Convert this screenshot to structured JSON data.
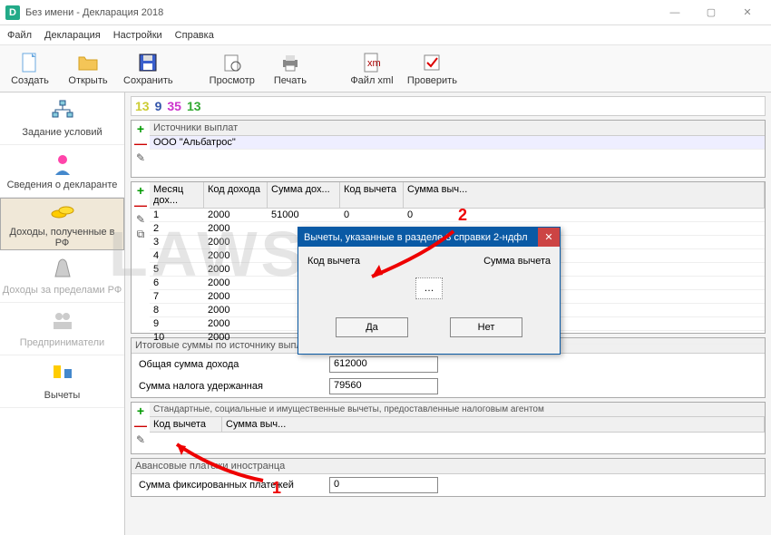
{
  "window": {
    "title": "Без имени - Декларация 2018"
  },
  "menu": [
    "Файл",
    "Декларация",
    "Настройки",
    "Справка"
  ],
  "toolbar": [
    {
      "label": "Создать",
      "icon": "file"
    },
    {
      "label": "Открыть",
      "icon": "folder"
    },
    {
      "label": "Сохранить",
      "icon": "disk"
    },
    {
      "label": "Просмотр",
      "icon": "preview"
    },
    {
      "label": "Печать",
      "icon": "printer"
    },
    {
      "label": "Файл xml",
      "icon": "xml"
    },
    {
      "label": "Проверить",
      "icon": "check"
    }
  ],
  "nav": [
    "Задание условий",
    "Сведения о декларанте",
    "Доходы, полученные в РФ",
    "Доходы за пределами РФ",
    "Предприниматели",
    "Вычеты"
  ],
  "nums": [
    "13",
    "9",
    "35",
    "13"
  ],
  "sources": {
    "header": "Источники выплат",
    "row": "ООО \"Альбатрос\""
  },
  "income_cols": [
    "Месяц дох...",
    "Код дохода",
    "Сумма дох...",
    "Код вычета",
    "Сумма выч..."
  ],
  "income_rows": [
    {
      "m": "1",
      "k": "2000",
      "s": "51000",
      "kv": "0",
      "sv": "0"
    },
    {
      "m": "2",
      "k": "2000",
      "s": "",
      "kv": "",
      "sv": ""
    },
    {
      "m": "3",
      "k": "2000",
      "s": "",
      "kv": "",
      "sv": ""
    },
    {
      "m": "4",
      "k": "2000",
      "s": "",
      "kv": "",
      "sv": ""
    },
    {
      "m": "5",
      "k": "2000",
      "s": "",
      "kv": "",
      "sv": ""
    },
    {
      "m": "6",
      "k": "2000",
      "s": "",
      "kv": "",
      "sv": ""
    },
    {
      "m": "7",
      "k": "2000",
      "s": "",
      "kv": "",
      "sv": ""
    },
    {
      "m": "8",
      "k": "2000",
      "s": "",
      "kv": "",
      "sv": ""
    },
    {
      "m": "9",
      "k": "2000",
      "s": "",
      "kv": "",
      "sv": ""
    },
    {
      "m": "10",
      "k": "2000",
      "s": "",
      "kv": "",
      "sv": ""
    }
  ],
  "totals": {
    "header": "Итоговые суммы по источнику выплат",
    "lbl_total": "Общая сумма дохода",
    "val_total": "612000",
    "lbl_tax": "Сумма налога удержанная",
    "val_tax": "79560"
  },
  "deduct": {
    "header": "Стандартные, социальные и имущественные вычеты, предоставленные налоговым агентом",
    "col1": "Код вычета",
    "col2": "Сумма выч..."
  },
  "advance": {
    "header": "Авансовые платежи иностранца",
    "lbl": "Сумма фиксированных платежей",
    "val": "0"
  },
  "dialog": {
    "title": "Вычеты, указанные в разделе 3 справки 2-ндфл",
    "lbl_code": "Код вычета",
    "lbl_sum": "Сумма вычета",
    "btn_yes": "Да",
    "btn_no": "Нет"
  },
  "annot": {
    "n1": "1",
    "n2": "2"
  }
}
